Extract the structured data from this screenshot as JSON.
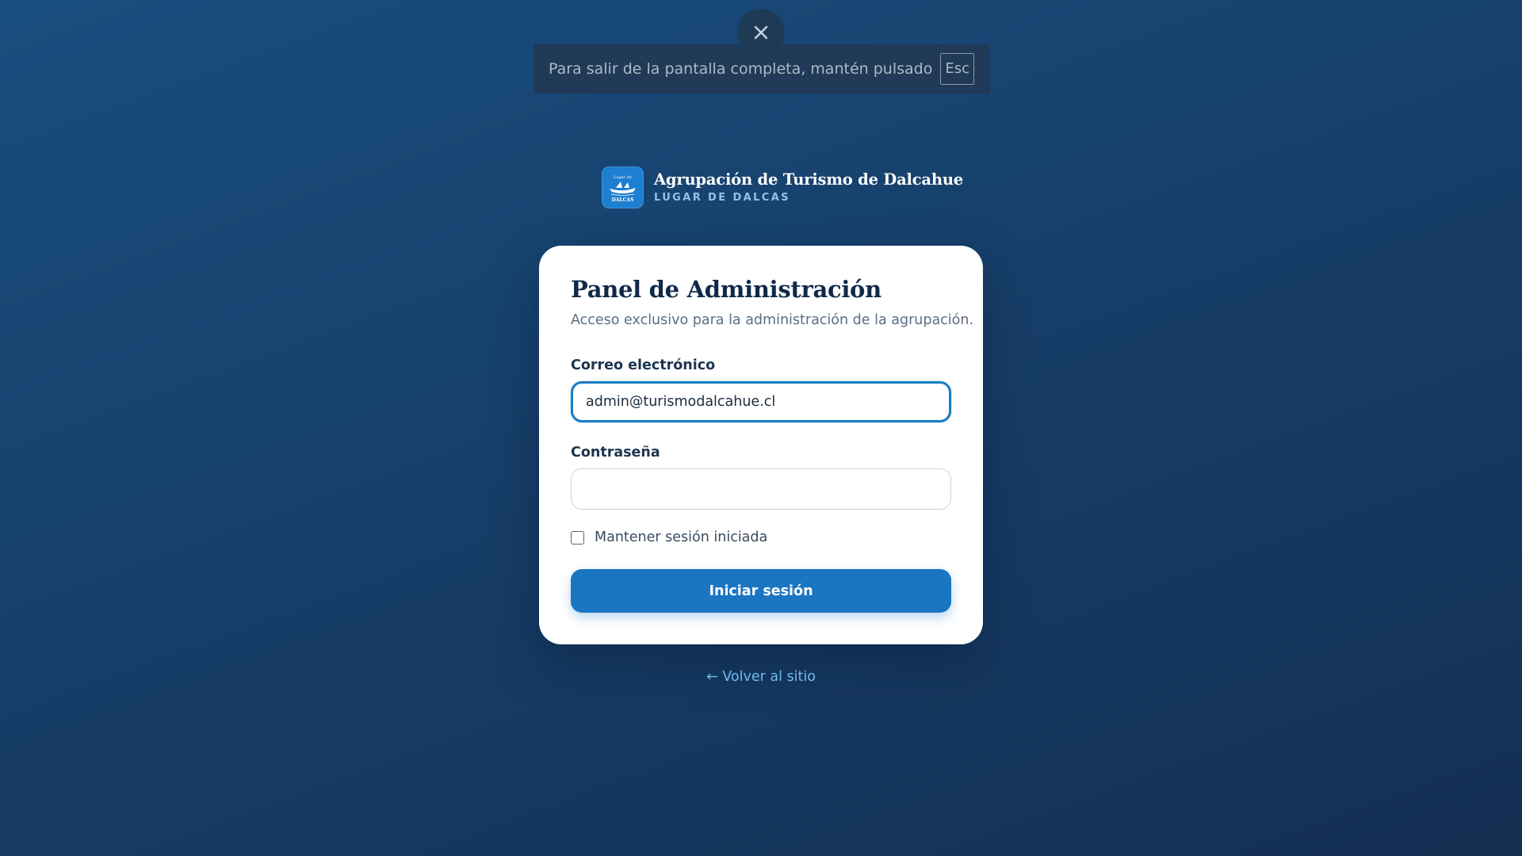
{
  "fullscreen_notice": {
    "text": "Para salir de la pantalla completa, mantén pulsado",
    "key": "Esc",
    "close_icon": "close-icon"
  },
  "brand": {
    "title": "Agrupación de Turismo de Dalcahue",
    "subtitle": "LUGAR DE DALCAS",
    "logo_text": "DALCAS",
    "logo_icon": "boat-logo-icon",
    "logo_color": "#1d7fd0"
  },
  "card": {
    "title": "Panel de Administración",
    "description": "Acceso exclusivo para la administración de la agrupación.",
    "email": {
      "label": "Correo electrónico",
      "value": "admin@turismodalcahue.cl",
      "placeholder": ""
    },
    "password": {
      "label": "Contraseña",
      "value": ""
    },
    "remember": {
      "label": "Mantener sesión iniciada",
      "checked": false
    },
    "submit_label": "Iniciar sesión"
  },
  "back_link": "← Volver al sitio",
  "colors": {
    "accent": "#1b76c2",
    "focus_border": "#1b7cc4",
    "link": "#72b8ee",
    "background_top": "#184e7e",
    "background_bottom": "#132f52"
  }
}
